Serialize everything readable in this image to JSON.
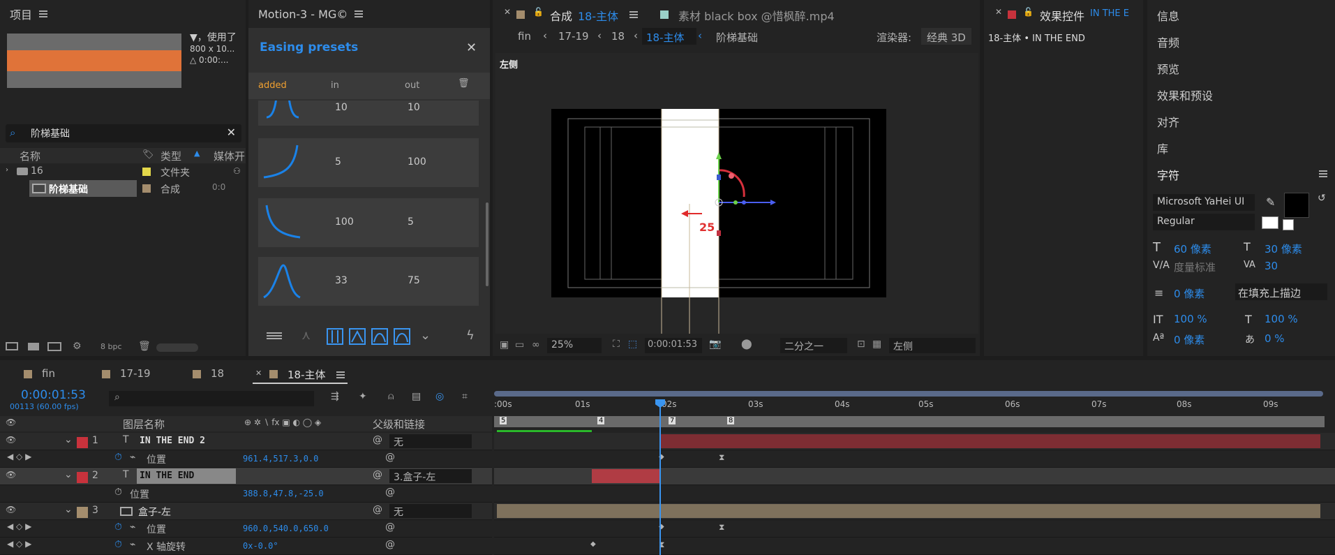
{
  "project": {
    "title": "项目",
    "info_line1": "▼，使用了",
    "info_line2": "800 x 10...",
    "info_line3": "△ 0:00:...",
    "search_value": "阶梯基础",
    "col_name": "名称",
    "col_type": "类型",
    "col_media": "媒体开",
    "items": [
      {
        "name": "16",
        "type": "文件夹",
        "color": "#e3d74a"
      },
      {
        "name": "阶梯基础",
        "type": "合成",
        "extra": "0:0",
        "color": "#a48d6d"
      }
    ],
    "bpc": "8 bpc"
  },
  "motion": {
    "title": "Motion-3 - MG©",
    "panel_title": "Easing presets",
    "col_added": "added",
    "col_in": "in",
    "col_out": "out",
    "presets": [
      {
        "in": "10",
        "out": "10"
      },
      {
        "in": "5",
        "out": "100"
      },
      {
        "in": "100",
        "out": "5"
      },
      {
        "in": "33",
        "out": "75"
      }
    ]
  },
  "comp": {
    "tab_label": "合成",
    "tab_name": "18-主体",
    "source_tab": "素材 black box @惜枫醉.mp4",
    "crumbs": [
      "fin",
      "17-19",
      "18",
      "18-主体",
      "阶梯基础"
    ],
    "renderer_label": "渲染器:",
    "renderer_value": "经典 3D",
    "view_label": "左侧",
    "handle_value": "25",
    "zoom": "25%",
    "timecode": "0:00:01:53",
    "resolution": "二分之一",
    "view_select": "左侧"
  },
  "effects": {
    "title": "效果控件",
    "title_layer": "IN THE E",
    "subtitle": "18-主体 • IN THE END"
  },
  "right_panels": [
    "信息",
    "音频",
    "预览",
    "效果和预设",
    "对齐",
    "库"
  ],
  "character": {
    "title": "字符",
    "font": "Microsoft YaHei UI",
    "style": "Regular",
    "size": "60 像素",
    "leading": "30 像素",
    "kerning": "度量标准",
    "tracking": "30",
    "stroke": "0 像素",
    "stroke_mode": "在填充上描边",
    "vscale": "100 %",
    "hscale": "100 %",
    "baseline": "0 像素",
    "tsume": "0 %"
  },
  "timeline": {
    "tabs": [
      "fin",
      "17-19",
      "18",
      "18-主体"
    ],
    "timecode": "0:00:01:53",
    "frames": "00113 (60.00 fps)",
    "col_layer_name": "图层名称",
    "col_parent": "父级和链接",
    "ticks": [
      ":00s",
      "01s",
      "02s",
      "03s",
      "04s",
      "05s",
      "06s",
      "07s",
      "08s",
      "09s"
    ],
    "markers": [
      "5",
      "4",
      "7",
      "8"
    ],
    "layers": [
      {
        "num": "1",
        "name": "IN THE END 2",
        "parent": "无",
        "color": "#c8323c"
      },
      {
        "prop": "位置",
        "value": "961.4,517.3,0.0"
      },
      {
        "num": "2",
        "name": "IN THE END",
        "parent": "3.盒子-左",
        "color": "#c8323c"
      },
      {
        "prop": "位置",
        "value": "388.8,47.8,-25.0"
      },
      {
        "num": "3",
        "name": "盒子-左",
        "parent": "无",
        "color": "#a48d6d"
      },
      {
        "prop": "位置",
        "value": "960.0,540.0,650.0"
      },
      {
        "prop": "X 轴旋转",
        "value": "0x-0.0°"
      }
    ]
  }
}
